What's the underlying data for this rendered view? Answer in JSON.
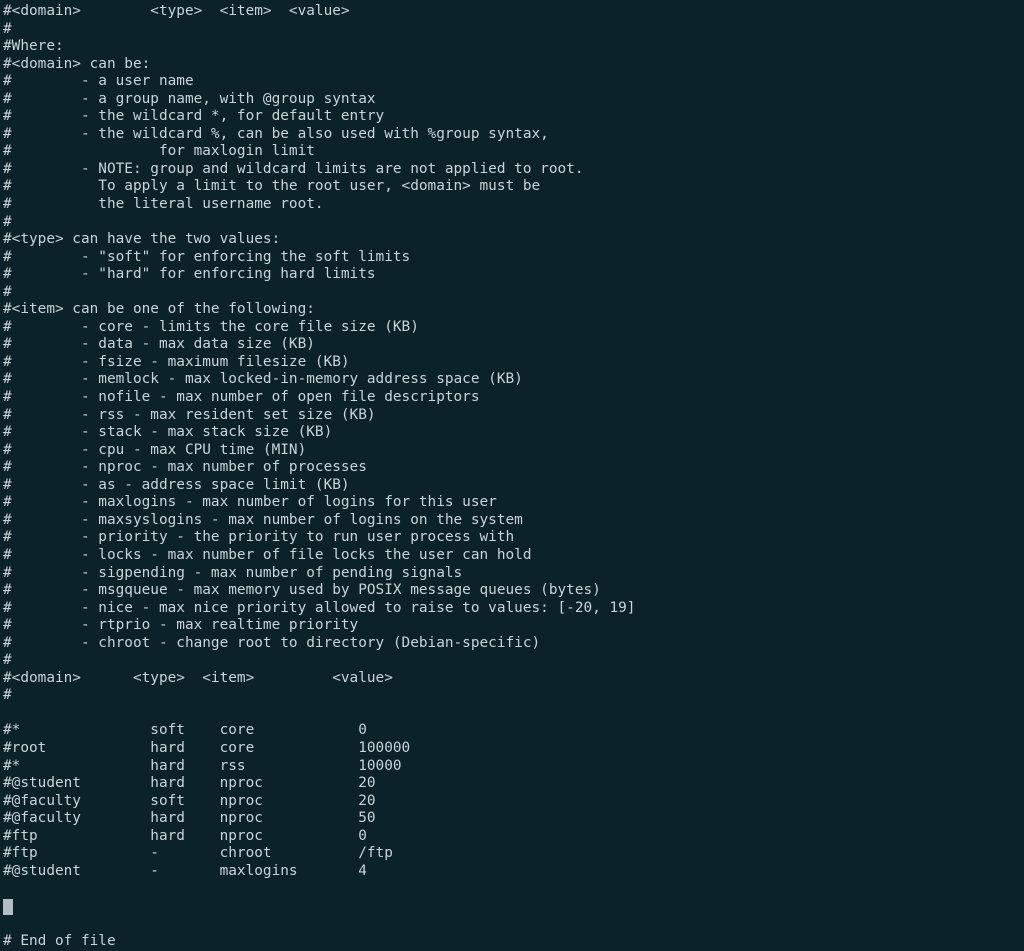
{
  "terminal": {
    "background_color": "#0c2229",
    "foreground_color": "#c9d4d6",
    "cursor_color": "#c9d4d6",
    "file_description": "limits.conf configuration file displayed in terminal editor",
    "cursor": {
      "line_index": 51,
      "column": 0,
      "glyph": "block-cursor"
    },
    "lines": [
      "#<domain>        <type>  <item>  <value>",
      "#",
      "#Where:",
      "#<domain> can be:",
      "#        - a user name",
      "#        - a group name, with @group syntax",
      "#        - the wildcard *, for default entry",
      "#        - the wildcard %, can be also used with %group syntax,",
      "#                 for maxlogin limit",
      "#        - NOTE: group and wildcard limits are not applied to root.",
      "#          To apply a limit to the root user, <domain> must be",
      "#          the literal username root.",
      "#",
      "#<type> can have the two values:",
      "#        - \"soft\" for enforcing the soft limits",
      "#        - \"hard\" for enforcing hard limits",
      "#",
      "#<item> can be one of the following:",
      "#        - core - limits the core file size (KB)",
      "#        - data - max data size (KB)",
      "#        - fsize - maximum filesize (KB)",
      "#        - memlock - max locked-in-memory address space (KB)",
      "#        - nofile - max number of open file descriptors",
      "#        - rss - max resident set size (KB)",
      "#        - stack - max stack size (KB)",
      "#        - cpu - max CPU time (MIN)",
      "#        - nproc - max number of processes",
      "#        - as - address space limit (KB)",
      "#        - maxlogins - max number of logins for this user",
      "#        - maxsyslogins - max number of logins on the system",
      "#        - priority - the priority to run user process with",
      "#        - locks - max number of file locks the user can hold",
      "#        - sigpending - max number of pending signals",
      "#        - msgqueue - max memory used by POSIX message queues (bytes)",
      "#        - nice - max nice priority allowed to raise to values: [-20, 19]",
      "#        - rtprio - max realtime priority",
      "#        - chroot - change root to directory (Debian-specific)",
      "#",
      "#<domain>      <type>  <item>         <value>",
      "#",
      "",
      "#*               soft    core            0",
      "#root            hard    core            100000",
      "#*               hard    rss             10000",
      "#@student        hard    nproc           20",
      "#@faculty        soft    nproc           20",
      "#@faculty        hard    nproc           50",
      "#ftp             hard    nproc           0",
      "#ftp             -       chroot          /ftp",
      "#@student        -       maxlogins       4",
      "",
      "",
      "",
      "# End of file"
    ],
    "entries_table": {
      "headers": [
        "<domain>",
        "<type>",
        "<item>",
        "<value>"
      ],
      "rows": [
        {
          "domain": "#*",
          "type": "soft",
          "item": "core",
          "value": "0"
        },
        {
          "domain": "#root",
          "type": "hard",
          "item": "core",
          "value": "100000"
        },
        {
          "domain": "#*",
          "type": "hard",
          "item": "rss",
          "value": "10000"
        },
        {
          "domain": "#@student",
          "type": "hard",
          "item": "nproc",
          "value": "20"
        },
        {
          "domain": "#@faculty",
          "type": "soft",
          "item": "nproc",
          "value": "20"
        },
        {
          "domain": "#@faculty",
          "type": "hard",
          "item": "nproc",
          "value": "50"
        },
        {
          "domain": "#ftp",
          "type": "hard",
          "item": "nproc",
          "value": "0"
        },
        {
          "domain": "#ftp",
          "type": "-",
          "item": "chroot",
          "value": "/ftp"
        },
        {
          "domain": "#@student",
          "type": "-",
          "item": "maxlogins",
          "value": "4"
        }
      ]
    },
    "end_marker": "# End of file"
  }
}
